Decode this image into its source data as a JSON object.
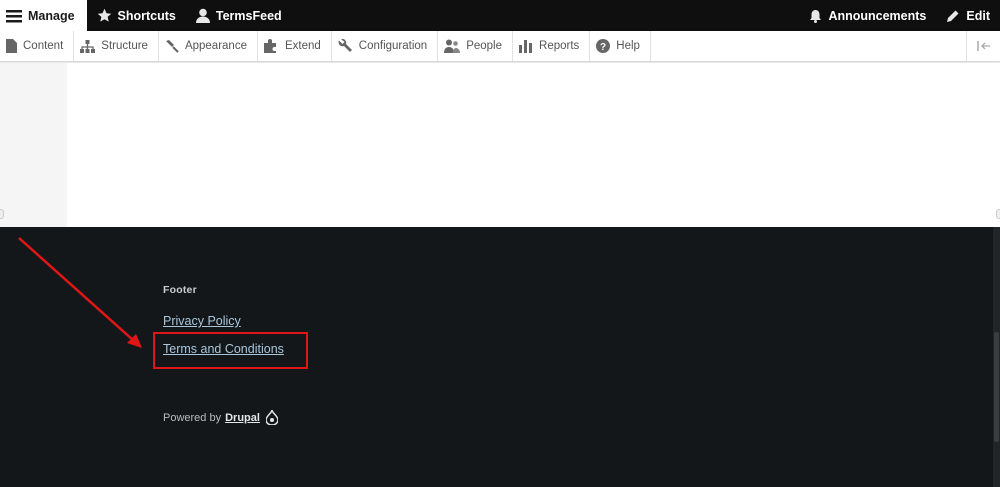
{
  "toolbar": {
    "manage": "Manage",
    "shortcuts": "Shortcuts",
    "site": "TermsFeed",
    "announcements": "Announcements",
    "edit": "Edit"
  },
  "tray": {
    "items": [
      "Content",
      "Structure",
      "Appearance",
      "Extend",
      "Configuration",
      "People",
      "Reports",
      "Help"
    ]
  },
  "footer": {
    "heading": "Footer",
    "links": [
      "Privacy Policy",
      "Terms and Conditions"
    ],
    "powered_by": "Powered by",
    "drupal": "Drupal"
  },
  "colors": {
    "toolbar_bg": "#0f0f0f",
    "footer_bg": "#141719",
    "link": "#a9c6db",
    "highlight": "#e01616"
  }
}
